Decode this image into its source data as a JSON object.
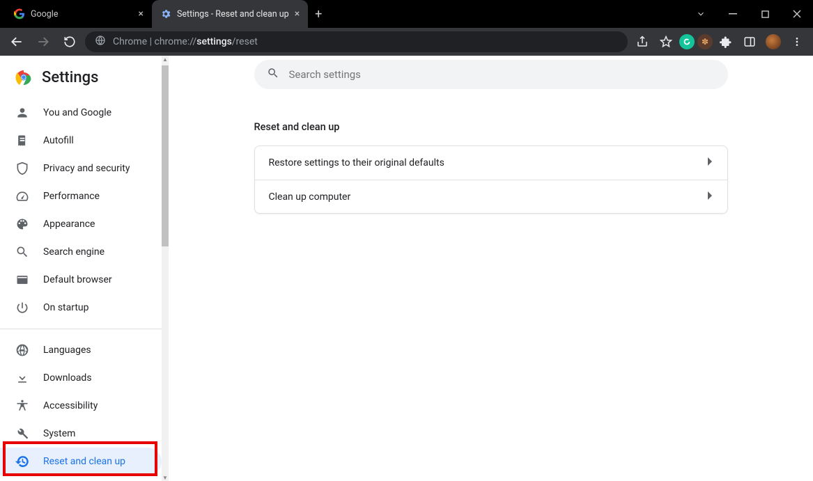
{
  "window": {
    "tabs": [
      {
        "title": "Google",
        "active": false
      },
      {
        "title": "Settings - Reset and clean up",
        "active": true
      }
    ]
  },
  "navbar": {
    "url_prefix": "Chrome",
    "url_host": "chrome://",
    "url_bold": "settings",
    "url_rest": "/reset"
  },
  "brand": {
    "title": "Settings"
  },
  "sidebar": {
    "groups": [
      [
        {
          "icon": "person",
          "label": "You and Google"
        },
        {
          "icon": "autofill",
          "label": "Autofill"
        },
        {
          "icon": "shield",
          "label": "Privacy and security"
        },
        {
          "icon": "speed",
          "label": "Performance"
        },
        {
          "icon": "palette",
          "label": "Appearance"
        },
        {
          "icon": "search",
          "label": "Search engine"
        },
        {
          "icon": "browser",
          "label": "Default browser"
        },
        {
          "icon": "power",
          "label": "On startup"
        }
      ],
      [
        {
          "icon": "globe",
          "label": "Languages"
        },
        {
          "icon": "download",
          "label": "Downloads"
        },
        {
          "icon": "access",
          "label": "Accessibility"
        },
        {
          "icon": "wrench",
          "label": "System"
        },
        {
          "icon": "restore",
          "label": "Reset and clean up",
          "active": true
        }
      ]
    ]
  },
  "main": {
    "search_placeholder": "Search settings",
    "section": "Reset and clean up",
    "rows": [
      "Restore settings to their original defaults",
      "Clean up computer"
    ]
  }
}
